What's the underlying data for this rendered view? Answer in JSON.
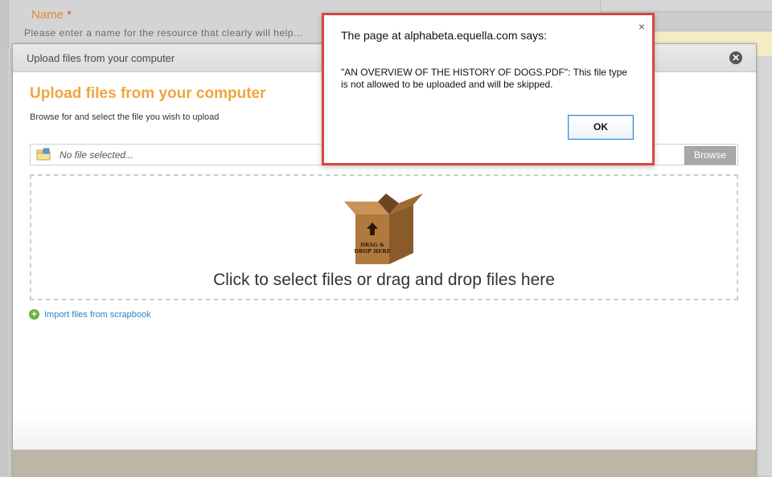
{
  "background": {
    "name_label": "Name",
    "required_marker": "*",
    "hint_text": "Please enter a name for the resource that clearly will help..."
  },
  "modal": {
    "title": "Upload files from your computer",
    "heading": "Upload files from your computer",
    "subheading": "Browse for and select the file you wish to upload",
    "file_placeholder": "No file selected...",
    "browse_label": "Browse",
    "drop_text": "Click to select files or drag and drop files here",
    "box_label_line1": "DRAG &",
    "box_label_line2": "DROP HERE",
    "import_link": "Import files from scrapbook",
    "close_glyph": "✕"
  },
  "alert": {
    "title": "The page at alphabeta.equella.com says:",
    "message": "\"AN OVERVIEW OF THE HISTORY OF DOGS.PDF\": This file type is not allowed to be uploaded and will be skipped.",
    "ok_label": "OK",
    "close_glyph": "×"
  },
  "icons": {
    "folder": "folder-icon",
    "box": "cardboard-box-icon",
    "add": "plus-circle-icon"
  },
  "colors": {
    "heading_orange": "#f0a43f",
    "link_blue": "#2a84c4",
    "alert_border": "#d94545",
    "ok_border": "#3d84d6"
  }
}
